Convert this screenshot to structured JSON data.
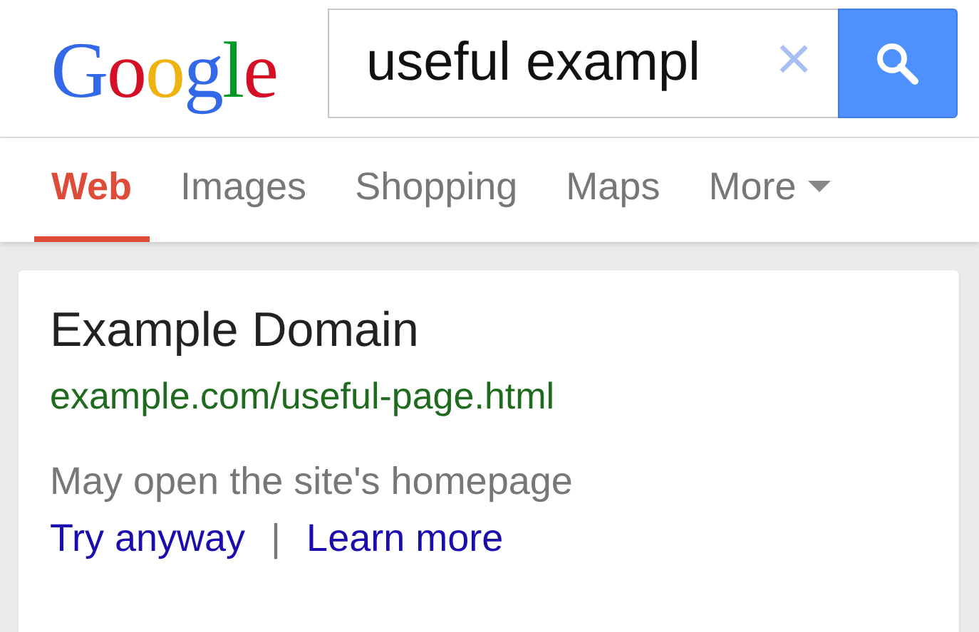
{
  "logo": "Google",
  "search": {
    "value": "useful exampl",
    "clear": "×"
  },
  "tabs": [
    {
      "label": "Web",
      "selected": true
    },
    {
      "label": "Images",
      "selected": false
    },
    {
      "label": "Shopping",
      "selected": false
    },
    {
      "label": "Maps",
      "selected": false
    },
    {
      "label": "More",
      "selected": false,
      "kind": "menu"
    }
  ],
  "result": {
    "title": "Example Domain",
    "url": "example.com/useful-page.html",
    "snippet": "May open the site's homepage",
    "links": [
      "Try anyway",
      "Learn more"
    ],
    "separator": "|"
  }
}
